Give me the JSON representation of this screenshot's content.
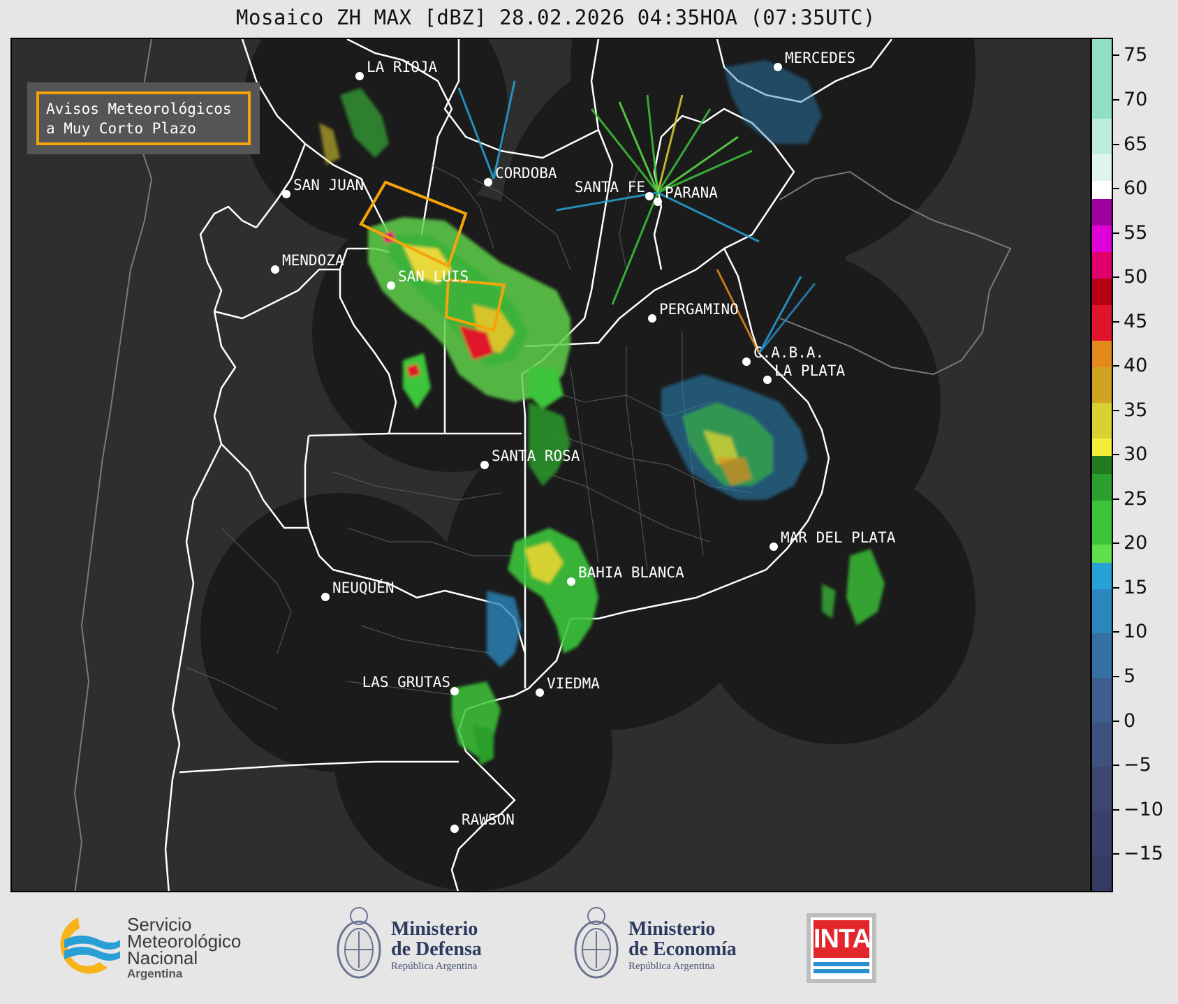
{
  "title": "Mosaico ZH MAX [dBZ] 28.02.2026 04:35HOA (07:35UTC)",
  "warning_box": {
    "line1": "Avisos Meteorológicos",
    "line2": "a Muy Corto Plazo",
    "border_color": "#f5a30a"
  },
  "cities": [
    {
      "name": "LA RIOJA"
    },
    {
      "name": "MERCEDES"
    },
    {
      "name": "CORDOBA"
    },
    {
      "name": "SAN JUAN"
    },
    {
      "name": "SANTA FE"
    },
    {
      "name": "PARANA"
    },
    {
      "name": "MENDOZA"
    },
    {
      "name": "SAN LUIS"
    },
    {
      "name": "PERGAMINO"
    },
    {
      "name": "C.A.B.A."
    },
    {
      "name": "LA PLATA"
    },
    {
      "name": "SANTA ROSA"
    },
    {
      "name": "MAR DEL PLATA"
    },
    {
      "name": "BAHIA BLANCA"
    },
    {
      "name": "NEUQUÉN"
    },
    {
      "name": "LAS GRUTAS"
    },
    {
      "name": "VIEDMA"
    },
    {
      "name": "RAWSON"
    }
  ],
  "colorbar": {
    "unit": "dBZ",
    "min": -19,
    "max": 77,
    "ticks": [
      "75",
      "70",
      "65",
      "60",
      "55",
      "50",
      "45",
      "40",
      "35",
      "30",
      "25",
      "20",
      "15",
      "10",
      "5",
      "0",
      "−5",
      "−10",
      "−15"
    ],
    "tick_values": [
      75,
      70,
      65,
      60,
      55,
      50,
      45,
      40,
      35,
      30,
      25,
      20,
      15,
      10,
      5,
      0,
      -5,
      -10,
      -15
    ],
    "bands": [
      {
        "from": -19,
        "to": -15,
        "color": "#363a63"
      },
      {
        "from": -15,
        "to": -10,
        "color": "#3a4069"
      },
      {
        "from": -10,
        "to": -5,
        "color": "#3d4772"
      },
      {
        "from": -5,
        "to": 0,
        "color": "#3f517d"
      },
      {
        "from": 0,
        "to": 5,
        "color": "#3e5e8d"
      },
      {
        "from": 5,
        "to": 10,
        "color": "#3570a3"
      },
      {
        "from": 10,
        "to": 15,
        "color": "#2a86bc"
      },
      {
        "from": 15,
        "to": 18,
        "color": "#27a2d6"
      },
      {
        "from": 18,
        "to": 20,
        "color": "#5ee04a"
      },
      {
        "from": 20,
        "to": 25,
        "color": "#3cc53a"
      },
      {
        "from": 25,
        "to": 28,
        "color": "#2ca02c"
      },
      {
        "from": 28,
        "to": 30,
        "color": "#207a20"
      },
      {
        "from": 30,
        "to": 32,
        "color": "#f4ee3a"
      },
      {
        "from": 32,
        "to": 36,
        "color": "#d6d232"
      },
      {
        "from": 36,
        "to": 40,
        "color": "#d0a420"
      },
      {
        "from": 40,
        "to": 43,
        "color": "#e48a1c"
      },
      {
        "from": 43,
        "to": 47,
        "color": "#e0142c"
      },
      {
        "from": 47,
        "to": 50,
        "color": "#b40012"
      },
      {
        "from": 50,
        "to": 53,
        "color": "#e0006a"
      },
      {
        "from": 53,
        "to": 56,
        "color": "#e000d8"
      },
      {
        "from": 56,
        "to": 59,
        "color": "#a000a0"
      },
      {
        "from": 59,
        "to": 61,
        "color": "#ffffff"
      },
      {
        "from": 61,
        "to": 64,
        "color": "#dff5ec"
      },
      {
        "from": 64,
        "to": 68,
        "color": "#bdeedc"
      },
      {
        "from": 68,
        "to": 77,
        "color": "#8fe0c2"
      }
    ]
  },
  "logos": {
    "smn": {
      "line1": "Servicio",
      "line2": "Meteorológico",
      "line3": "Nacional",
      "line4": "Argentina"
    },
    "defensa": {
      "line1": "Ministerio",
      "line2": "de Defensa",
      "line3": "República Argentina"
    },
    "economia": {
      "line1": "Ministerio",
      "line2": "de Economía",
      "line3": "República Argentina"
    },
    "inta": {
      "text": "INTA"
    }
  },
  "colors": {
    "map_background": "#2e2e2e",
    "radar_coverage": "#1b1b1b",
    "province_border": "#ffffff",
    "district_border": "#6e6e6e",
    "city_dot": "#ffffff",
    "warning_polygon": "#f5a30a"
  }
}
